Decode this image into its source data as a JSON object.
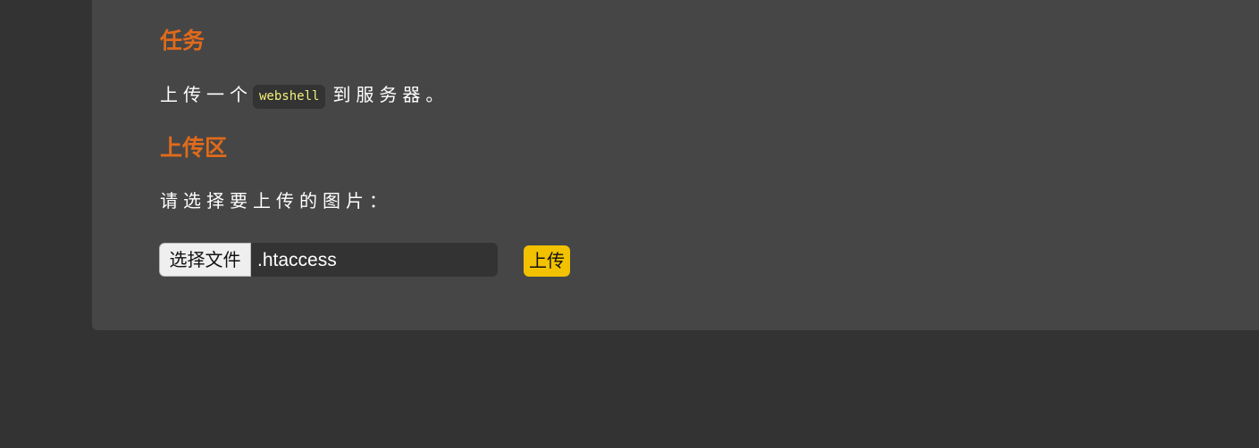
{
  "task": {
    "title": "任务",
    "text_before_code": "上传一个",
    "code": "webshell",
    "text_after_code": "到服务器。"
  },
  "upload": {
    "title": "上传区",
    "prompt": "请选择要上传的图片：",
    "choose_file_label": "选择文件",
    "selected_file": ".htaccess",
    "submit_label": "上传"
  },
  "colors": {
    "page_background": "#333333",
    "card_background": "#464646",
    "heading": "#e06a1b",
    "code_text": "#f3f17a",
    "submit_button": "#f2c200"
  }
}
